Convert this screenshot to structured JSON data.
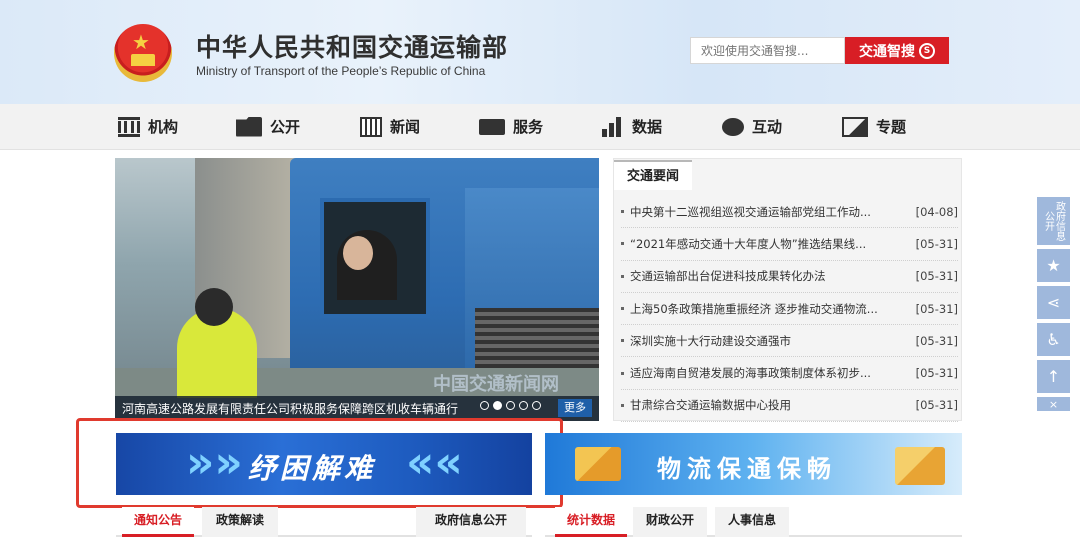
{
  "header": {
    "title": "中华人民共和国交通运输部",
    "subtitle": "Ministry of Transport of the People’s Republic of China",
    "search_placeholder": "欢迎使用交通智搜...",
    "search_button": "交通智搜"
  },
  "nav": {
    "items": [
      {
        "label": "机构",
        "icon": "building-icon"
      },
      {
        "label": "公开",
        "icon": "folder-icon"
      },
      {
        "label": "新闻",
        "icon": "calendar-icon"
      },
      {
        "label": "服务",
        "icon": "monitor-icon"
      },
      {
        "label": "数据",
        "icon": "bar-chart-icon"
      },
      {
        "label": "互动",
        "icon": "chat-icon"
      },
      {
        "label": "专题",
        "icon": "image-icon"
      }
    ]
  },
  "slideshow": {
    "caption": "河南高速公路发展有限责任公司积极服务保障跨区机收车辆通行",
    "watermark": "中国交通新闻网",
    "more": "更多",
    "slide_count": 5,
    "active_index": 1
  },
  "news": {
    "tab": "交通要闻",
    "items": [
      {
        "title": "中央第十二巡视组巡视交通运输部党组工作动...",
        "date": "[04-08]"
      },
      {
        "title": "“2021年感动交通十大年度人物”推选结果线...",
        "date": "[05-31]"
      },
      {
        "title": "交通运输部出台促进科技成果转化办法",
        "date": "[05-31]"
      },
      {
        "title": "上海50条政策措施重振经济 逐步推动交通物流...",
        "date": "[05-31]"
      },
      {
        "title": "深圳实施十大行动建设交通强市",
        "date": "[05-31]"
      },
      {
        "title": "适应海南自贸港发展的海事政策制度体系初步...",
        "date": "[05-31]"
      },
      {
        "title": "甘肃综合交通运输数据中心投用",
        "date": "[05-31]"
      }
    ]
  },
  "side_toolbar": {
    "gov_info": "政府信息公开",
    "items": [
      "star-icon",
      "share-icon",
      "accessibility-icon",
      "arrow-up-icon",
      "close-icon"
    ]
  },
  "banners": {
    "left_text": "纾困解难",
    "right_text": "物流保通保畅"
  },
  "tabs_left": [
    "通知公告",
    "政策解读",
    "政府信息公开"
  ],
  "tabs_right": [
    "统计数据",
    "财政公开",
    "人事信息"
  ],
  "colors": {
    "accent_red": "#d81e25",
    "highlight_red": "#e03a2e",
    "header_blue": "#dbe9f8"
  }
}
